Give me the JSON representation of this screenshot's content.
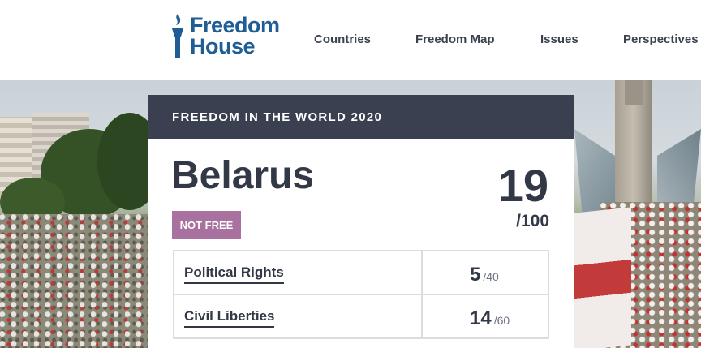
{
  "header": {
    "logo": {
      "line1": "Freedom",
      "line2": "House"
    },
    "nav": [
      {
        "label": "Countries"
      },
      {
        "label": "Freedom Map"
      },
      {
        "label": "Issues"
      },
      {
        "label": "Perspectives"
      }
    ]
  },
  "card": {
    "heading": "FREEDOM IN THE WORLD 2020",
    "country": "Belarus",
    "status": "NOT FREE",
    "status_color": "#a9719f",
    "score": "19",
    "score_total": "/100",
    "rows": [
      {
        "label": "Political Rights",
        "value": "5",
        "max": "/40"
      },
      {
        "label": "Civil Liberties",
        "value": "14",
        "max": "/60"
      }
    ]
  },
  "colors": {
    "brand_blue": "#1f5d94",
    "header_bar": "#3a4050",
    "text_dark": "#323846"
  }
}
